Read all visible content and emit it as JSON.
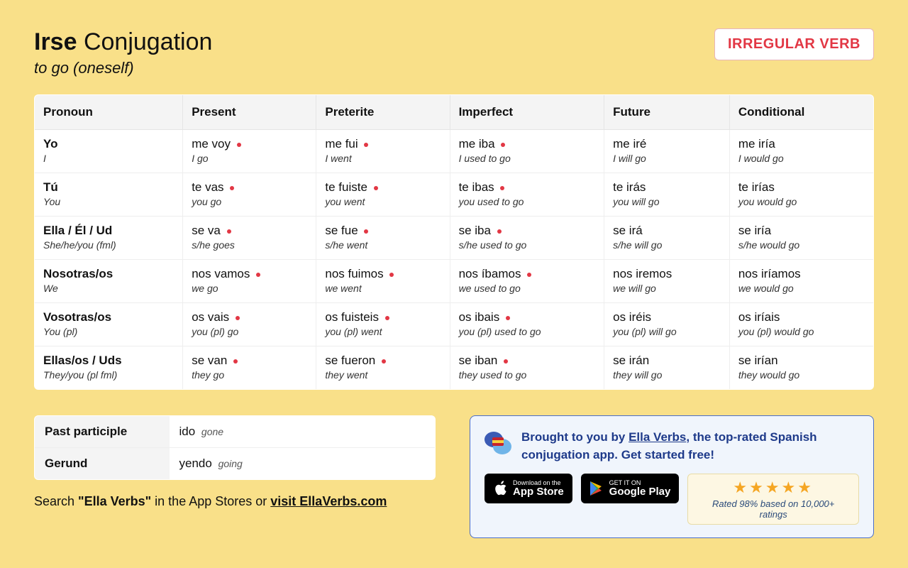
{
  "header": {
    "verb": "Irse",
    "title_suffix": "Conjugation",
    "subtitle": "to go (oneself)",
    "badge": "IRREGULAR VERB"
  },
  "columns": [
    "Pronoun",
    "Present",
    "Preterite",
    "Imperfect",
    "Future",
    "Conditional"
  ],
  "rows": [
    {
      "pronoun": "Yo",
      "pronoun_sub": "I",
      "cells": [
        {
          "v": "me voy",
          "t": "I go",
          "irr": true
        },
        {
          "v": "me fui",
          "t": "I went",
          "irr": true
        },
        {
          "v": "me iba",
          "t": "I used to go",
          "irr": true
        },
        {
          "v": "me iré",
          "t": "I will go",
          "irr": false
        },
        {
          "v": "me iría",
          "t": "I would go",
          "irr": false
        }
      ]
    },
    {
      "pronoun": "Tú",
      "pronoun_sub": "You",
      "cells": [
        {
          "v": "te vas",
          "t": "you go",
          "irr": true
        },
        {
          "v": "te fuiste",
          "t": "you went",
          "irr": true
        },
        {
          "v": "te ibas",
          "t": "you used to go",
          "irr": true
        },
        {
          "v": "te irás",
          "t": "you will go",
          "irr": false
        },
        {
          "v": "te irías",
          "t": "you would go",
          "irr": false
        }
      ]
    },
    {
      "pronoun": "Ella / Él / Ud",
      "pronoun_sub": "She/he/you (fml)",
      "cells": [
        {
          "v": "se va",
          "t": "s/he goes",
          "irr": true
        },
        {
          "v": "se fue",
          "t": "s/he went",
          "irr": true
        },
        {
          "v": "se iba",
          "t": "s/he used to go",
          "irr": true
        },
        {
          "v": "se irá",
          "t": "s/he will go",
          "irr": false
        },
        {
          "v": "se iría",
          "t": "s/he would go",
          "irr": false
        }
      ]
    },
    {
      "pronoun": "Nosotras/os",
      "pronoun_sub": "We",
      "cells": [
        {
          "v": "nos vamos",
          "t": "we go",
          "irr": true
        },
        {
          "v": "nos fuimos",
          "t": "we went",
          "irr": true
        },
        {
          "v": "nos íbamos",
          "t": "we used to go",
          "irr": true
        },
        {
          "v": "nos iremos",
          "t": "we will go",
          "irr": false
        },
        {
          "v": "nos iríamos",
          "t": "we would go",
          "irr": false
        }
      ]
    },
    {
      "pronoun": "Vosotras/os",
      "pronoun_sub": "You (pl)",
      "cells": [
        {
          "v": "os vais",
          "t": "you (pl) go",
          "irr": true
        },
        {
          "v": "os fuisteis",
          "t": "you (pl) went",
          "irr": true
        },
        {
          "v": "os ibais",
          "t": "you (pl) used to go",
          "irr": true
        },
        {
          "v": "os iréis",
          "t": "you (pl) will go",
          "irr": false
        },
        {
          "v": "os iríais",
          "t": "you (pl) would go",
          "irr": false
        }
      ]
    },
    {
      "pronoun": "Ellas/os / Uds",
      "pronoun_sub": "They/you (pl fml)",
      "cells": [
        {
          "v": "se van",
          "t": "they go",
          "irr": true
        },
        {
          "v": "se fueron",
          "t": "they went",
          "irr": true
        },
        {
          "v": "se iban",
          "t": "they used to go",
          "irr": true
        },
        {
          "v": "se irán",
          "t": "they will go",
          "irr": false
        },
        {
          "v": "se irían",
          "t": "they would go",
          "irr": false
        }
      ]
    }
  ],
  "extras": {
    "past_participle_label": "Past participle",
    "past_participle": "ido",
    "past_participle_sub": "gone",
    "gerund_label": "Gerund",
    "gerund": "yendo",
    "gerund_sub": "going"
  },
  "search_line": {
    "prefix": "Search ",
    "bold": "\"Ella Verbs\"",
    "mid": " in the App Stores or ",
    "link": "visit EllaVerbs.com"
  },
  "promo": {
    "text_prefix": "Brought to you by ",
    "link": "Ella Verbs",
    "text_suffix": ", the top-rated Spanish conjugation app. Get started free!",
    "appstore_small": "Download on the",
    "appstore_big": "App Store",
    "play_small": "GET IT ON",
    "play_big": "Google Play",
    "stars": "★★★★★",
    "rating": "Rated 98% based on 10,000+ ratings"
  }
}
